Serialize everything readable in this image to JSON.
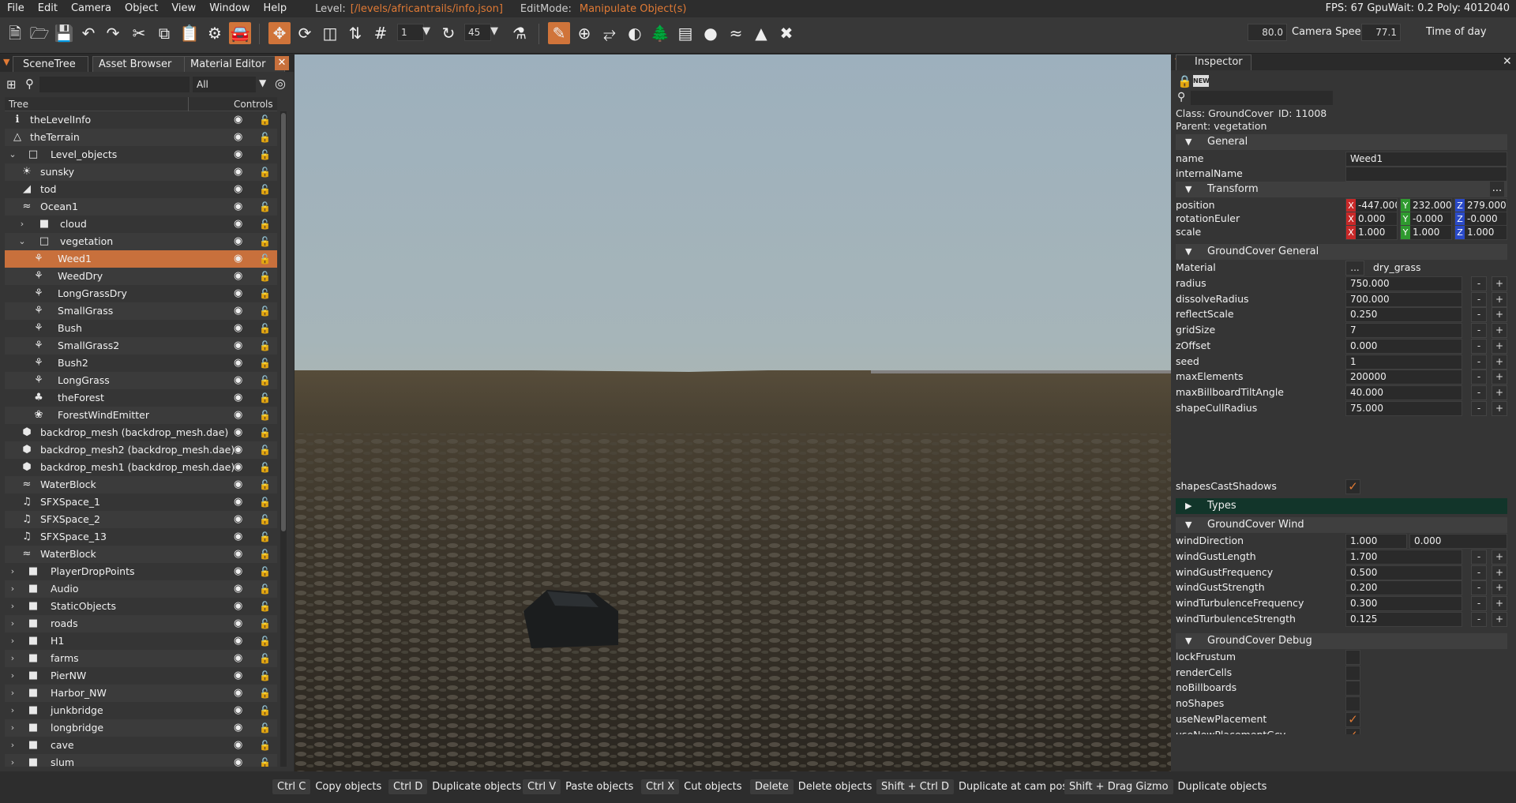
{
  "menubar": {
    "items": [
      "File",
      "Edit",
      "Camera",
      "Object",
      "View",
      "Window",
      "Help"
    ],
    "level_key": "Level:",
    "level_value": "[/levels/africantrails/info.json]",
    "editmode_key": "EditMode:",
    "editmode_value": "Manipulate Object(s)",
    "stats": "FPS: 67  GpuWait: 0.2  Poly: 4012040"
  },
  "toolbar": {
    "grid_value": "1",
    "rotate_value": "45",
    "camera_speed_value": "80.0",
    "camera_speed_label": "Camera Speed",
    "time_of_day_value": "77.1",
    "time_of_day_label": "Time of day",
    "icons": [
      "new-file-icon",
      "open-folder-icon",
      "save-icon",
      "undo-icon",
      "redo-icon",
      "cut-icon",
      "copy-icon",
      "paste-icon",
      "settings-icon",
      "vehicle-icon",
      "move-icon",
      "rotate-icon",
      "scale-icon",
      "snap-icon",
      "grid-icon",
      "angle-icon",
      "terrain-icon",
      "pencil-icon",
      "add-icon",
      "road-icon",
      "material-icon",
      "forest-icon",
      "layers-icon",
      "decal-icon",
      "river-icon",
      "meshroad-icon",
      "navmesh-icon"
    ]
  },
  "left_tabs": [
    "SceneTree",
    "Asset Browser",
    "Material Editor"
  ],
  "tree": {
    "filter": "All",
    "col_tree": "Tree",
    "col_controls": "Controls",
    "rows": [
      {
        "label": "theLevelInfo",
        "indent": 0,
        "icon": "ℹ",
        "exp": ""
      },
      {
        "label": "theTerrain",
        "indent": 0,
        "icon": "△",
        "exp": ""
      },
      {
        "label": "Level_objects",
        "indent": 1,
        "icon": "□",
        "exp": "⌄"
      },
      {
        "label": "sunsky",
        "indent": 2,
        "icon": "☀",
        "exp": ""
      },
      {
        "label": "tod",
        "indent": 2,
        "icon": "◢",
        "exp": ""
      },
      {
        "label": "Ocean1",
        "indent": 2,
        "icon": "≈",
        "exp": ""
      },
      {
        "label": "cloud",
        "indent": 3,
        "icon": "■",
        "exp": "›"
      },
      {
        "label": "vegetation",
        "indent": 3,
        "icon": "□",
        "exp": "⌄"
      },
      {
        "label": "Weed1",
        "indent": 4,
        "icon": "⚘",
        "exp": "",
        "sel": true
      },
      {
        "label": "WeedDry",
        "indent": 4,
        "icon": "⚘",
        "exp": ""
      },
      {
        "label": "LongGrassDry",
        "indent": 4,
        "icon": "⚘",
        "exp": ""
      },
      {
        "label": "SmallGrass",
        "indent": 4,
        "icon": "⚘",
        "exp": ""
      },
      {
        "label": "Bush",
        "indent": 4,
        "icon": "⚘",
        "exp": ""
      },
      {
        "label": "SmallGrass2",
        "indent": 4,
        "icon": "⚘",
        "exp": ""
      },
      {
        "label": "Bush2",
        "indent": 4,
        "icon": "⚘",
        "exp": ""
      },
      {
        "label": "LongGrass",
        "indent": 4,
        "icon": "⚘",
        "exp": ""
      },
      {
        "label": "theForest",
        "indent": 4,
        "icon": "♣",
        "exp": ""
      },
      {
        "label": "ForestWindEmitter",
        "indent": 4,
        "icon": "❀",
        "exp": ""
      },
      {
        "label": "backdrop_mesh (backdrop_mesh.dae)",
        "indent": 2,
        "icon": "⬢",
        "exp": ""
      },
      {
        "label": "backdrop_mesh2 (backdrop_mesh.dae)",
        "indent": 2,
        "icon": "⬢",
        "exp": ""
      },
      {
        "label": "backdrop_mesh1 (backdrop_mesh.dae)",
        "indent": 2,
        "icon": "⬢",
        "exp": ""
      },
      {
        "label": "WaterBlock",
        "indent": 2,
        "icon": "≈",
        "exp": ""
      },
      {
        "label": "SFXSpace_1",
        "indent": 2,
        "icon": "♫",
        "exp": ""
      },
      {
        "label": "SFXSpace_2",
        "indent": 2,
        "icon": "♫",
        "exp": ""
      },
      {
        "label": "SFXSpace_13",
        "indent": 2,
        "icon": "♫",
        "exp": ""
      },
      {
        "label": "WaterBlock",
        "indent": 2,
        "icon": "≈",
        "exp": ""
      },
      {
        "label": "PlayerDropPoints",
        "indent": 1,
        "icon": "■",
        "exp": "›"
      },
      {
        "label": "Audio",
        "indent": 1,
        "icon": "■",
        "exp": "›"
      },
      {
        "label": "StaticObjects",
        "indent": 1,
        "icon": "■",
        "exp": "›"
      },
      {
        "label": "roads",
        "indent": 1,
        "icon": "■",
        "exp": "›"
      },
      {
        "label": "H1",
        "indent": 1,
        "icon": "■",
        "exp": "›"
      },
      {
        "label": "farms",
        "indent": 1,
        "icon": "■",
        "exp": "›"
      },
      {
        "label": "PierNW",
        "indent": 1,
        "icon": "■",
        "exp": "›"
      },
      {
        "label": "Harbor_NW",
        "indent": 1,
        "icon": "■",
        "exp": "›"
      },
      {
        "label": "junkbridge",
        "indent": 1,
        "icon": "■",
        "exp": "›"
      },
      {
        "label": "longbridge",
        "indent": 1,
        "icon": "■",
        "exp": "›"
      },
      {
        "label": "cave",
        "indent": 1,
        "icon": "■",
        "exp": "›"
      },
      {
        "label": "slum",
        "indent": 1,
        "icon": "■",
        "exp": "›"
      }
    ]
  },
  "inspector": {
    "title": "Inspector",
    "class_label": "Class:  GroundCover",
    "id_label": "ID:  11008",
    "parent_label": "Parent:  vegetation",
    "sections": {
      "general": "General",
      "transform": "Transform",
      "gc_general": "GroundCover General",
      "types": "Types",
      "gc_wind": "GroundCover Wind",
      "gc_debug": "GroundCover Debug"
    },
    "name_label": "name",
    "name_value": "Weed1",
    "internal_label": "internalName",
    "transform_more": "...",
    "position": {
      "label": "position",
      "x": "-447.000",
      "y": "232.000",
      "z": "279.000"
    },
    "rotation": {
      "label": "rotationEuler",
      "x": "0.000",
      "y": "-0.000",
      "z": "-0.000"
    },
    "scale": {
      "label": "scale",
      "x": "1.000",
      "y": "1.000",
      "z": "1.000"
    },
    "material_label": "Material",
    "material_btn": "...",
    "material_value": "dry_grass",
    "numeric": [
      {
        "label": "radius",
        "value": "750.000"
      },
      {
        "label": "dissolveRadius",
        "value": "700.000"
      },
      {
        "label": "reflectScale",
        "value": "0.250"
      },
      {
        "label": "gridSize",
        "value": "7"
      },
      {
        "label": "zOffset",
        "value": "0.000"
      },
      {
        "label": "seed",
        "value": "1"
      },
      {
        "label": "maxElements",
        "value": "200000"
      },
      {
        "label": "maxBillboardTiltAngle",
        "value": "40.000"
      },
      {
        "label": "shapeCullRadius",
        "value": "75.000"
      }
    ],
    "shapes_cast_label": "shapesCastShadows",
    "wind_dir_label": "windDirection",
    "wind_dir_x": "1.000",
    "wind_dir_y": "0.000",
    "wind": [
      {
        "label": "windGustLength",
        "value": "1.700"
      },
      {
        "label": "windGustFrequency",
        "value": "0.500"
      },
      {
        "label": "windGustStrength",
        "value": "0.200"
      },
      {
        "label": "windTurbulenceFrequency",
        "value": "0.300"
      },
      {
        "label": "windTurbulenceStrength",
        "value": "0.125"
      }
    ],
    "debug": [
      {
        "label": "lockFrustum",
        "checked": false
      },
      {
        "label": "renderCells",
        "checked": false
      },
      {
        "label": "noBillboards",
        "checked": false
      },
      {
        "label": "noShapes",
        "checked": false
      },
      {
        "label": "useNewPlacement",
        "checked": true
      },
      {
        "label": "useNewPlacementGcv",
        "checked": true
      }
    ],
    "minus": "-",
    "plus": "+"
  },
  "shortcuts": [
    {
      "key": "Ctrl C",
      "desc": "Copy objects"
    },
    {
      "key": "Ctrl D",
      "desc": "Duplicate objects"
    },
    {
      "key": "Ctrl V",
      "desc": "Paste objects"
    },
    {
      "key": "Ctrl X",
      "desc": "Cut objects"
    },
    {
      "key": "Delete",
      "desc": "Delete objects"
    },
    {
      "key": "Shift + Ctrl D",
      "desc": "Duplicate at cam pos"
    },
    {
      "key": "Shift + Drag Gizmo",
      "desc": "Duplicate objects"
    }
  ],
  "colors": {
    "accent": "#c8703c",
    "types_bg": "#12352a",
    "check": "#e07a35"
  }
}
